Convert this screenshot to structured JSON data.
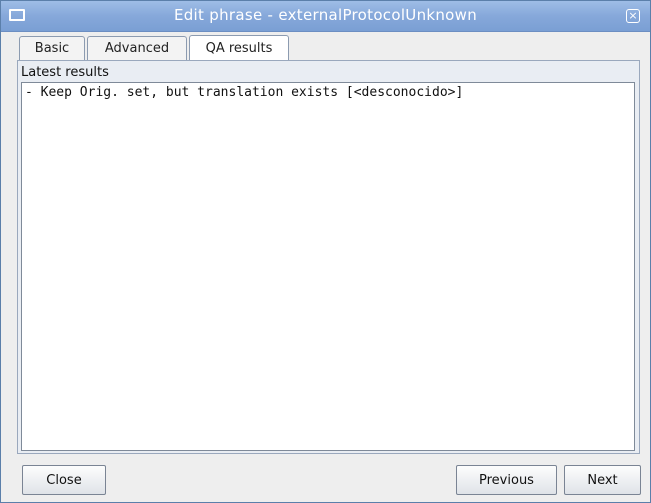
{
  "window": {
    "title": "Edit phrase - externalProtocolUnknown",
    "close_glyph": "×"
  },
  "tabs": [
    {
      "label": "Basic"
    },
    {
      "label": "Advanced"
    },
    {
      "label": "QA results"
    }
  ],
  "panel": {
    "label": "Latest results",
    "content": "- Keep Orig. set, but translation exists [<desconocido>]"
  },
  "buttons": {
    "close": "Close",
    "previous": "Previous",
    "next": "Next"
  }
}
